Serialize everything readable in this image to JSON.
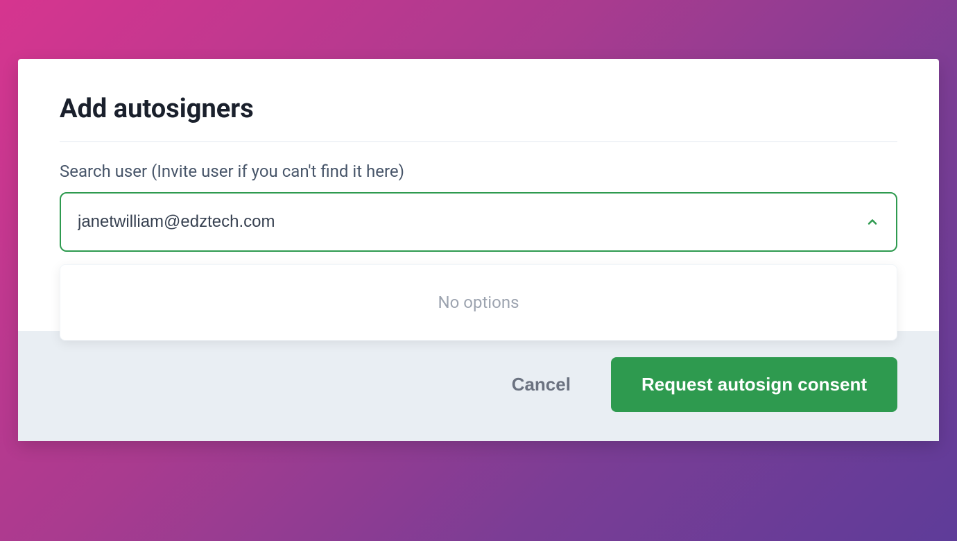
{
  "modal": {
    "title": "Add autosigners",
    "search": {
      "label": "Search user (Invite user if you can't find it here)",
      "value": "janetwilliam@edztech.com",
      "no_options": "No options"
    },
    "footer": {
      "cancel_label": "Cancel",
      "primary_label": "Request autosign consent"
    }
  },
  "colors": {
    "accent_green": "#2e9a4f",
    "text_dark": "#1a202c",
    "text_muted": "#6b7280"
  }
}
